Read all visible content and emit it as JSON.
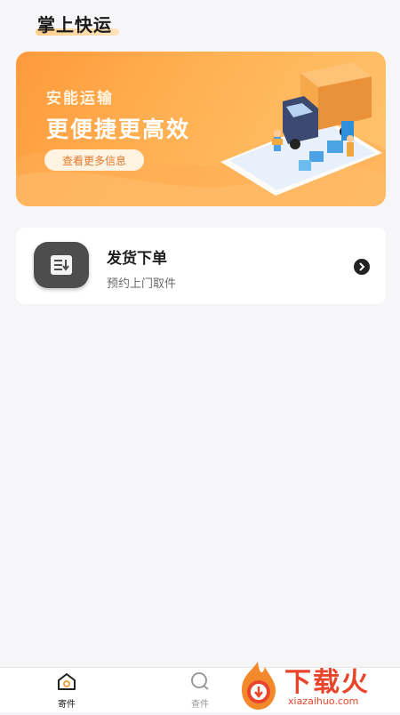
{
  "header": {
    "title": "掌上快运"
  },
  "banner": {
    "kicker": "安能运输",
    "headline": "更便捷更高效",
    "button_label": "查看更多信息"
  },
  "order_card": {
    "title": "发货下单",
    "subtitle": "预约上门取件"
  },
  "tabbar": {
    "tabs": [
      {
        "label": "寄件",
        "icon": "home-icon",
        "active": true
      },
      {
        "label": "查件",
        "icon": "search-icon",
        "active": false
      }
    ]
  },
  "watermark": {
    "text": "下载火",
    "url": "xiazaihuo.com"
  },
  "colors": {
    "accent": "#ff9a3c",
    "background": "#f6f6f8",
    "watermark": "#e8452b"
  }
}
